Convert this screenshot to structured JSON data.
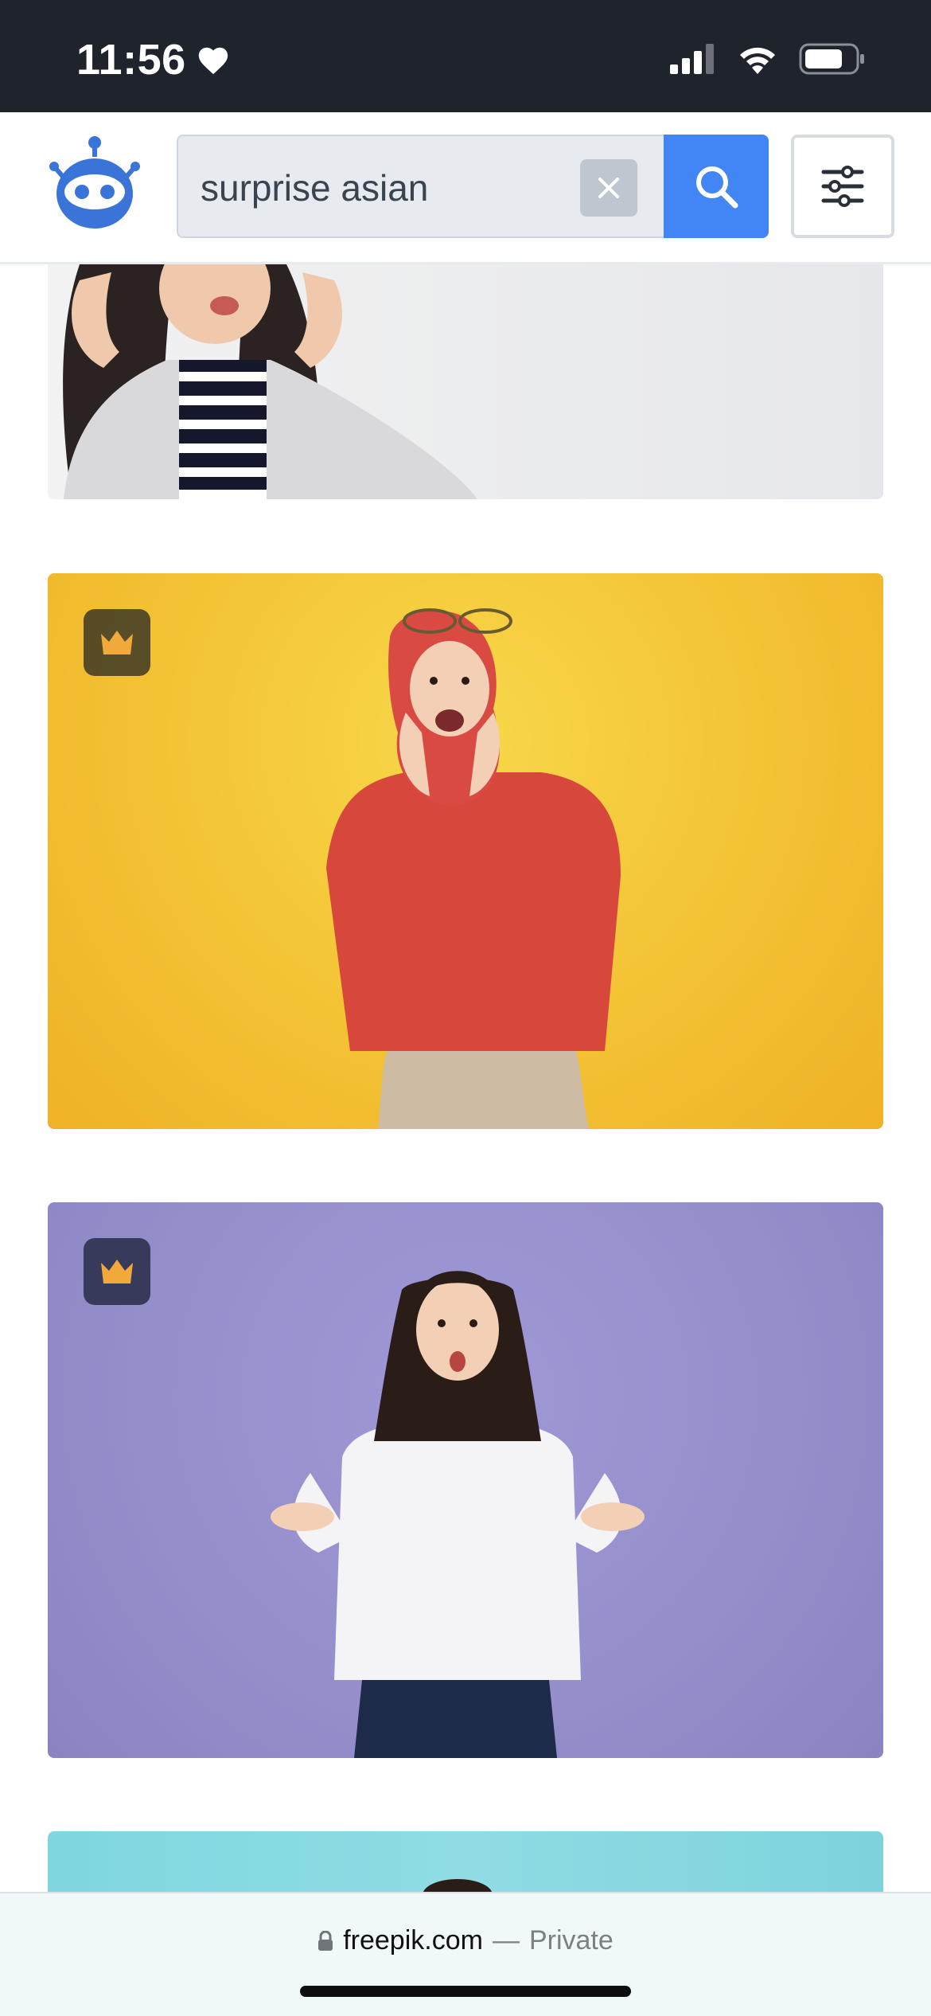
{
  "status_bar": {
    "time": "11:56",
    "icons": [
      "heart-icon",
      "signal-icon",
      "wifi-icon",
      "battery-icon"
    ]
  },
  "header": {
    "logo": "freepik-robot-logo",
    "search": {
      "value": "surprise asian",
      "clear_icon": "close-icon",
      "search_icon": "search-icon"
    },
    "filter_icon": "sliders-icon"
  },
  "results": [
    {
      "premium": false
    },
    {
      "premium": true,
      "badge_icon": "crown-icon"
    },
    {
      "premium": true,
      "badge_icon": "crown-icon"
    },
    {
      "premium": false
    }
  ],
  "browser_bar": {
    "domain": "freepik.com",
    "separator": "—",
    "mode": "Private",
    "lock_icon": "lock-icon"
  },
  "colors": {
    "status_bar_bg": "#1f242c",
    "accent_blue": "#4285f4",
    "badge_crown": "#f2a93b"
  }
}
